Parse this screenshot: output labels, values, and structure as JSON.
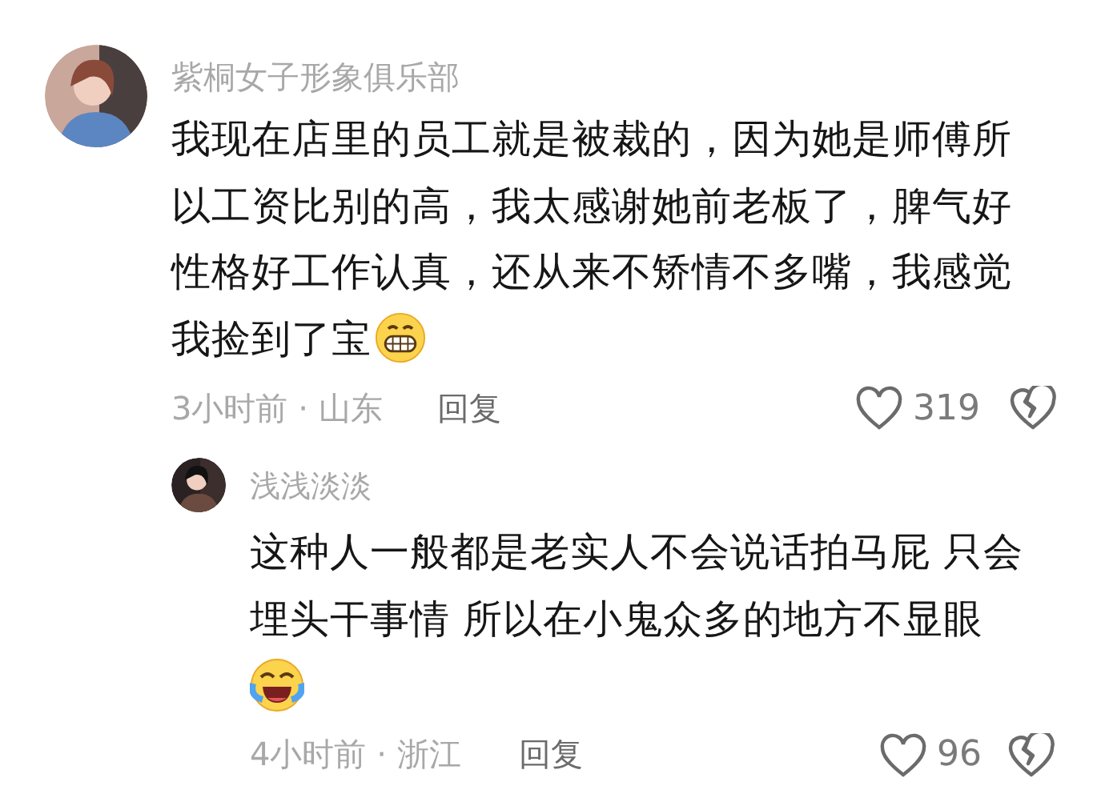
{
  "comments": [
    {
      "author": "紫桐女子形象俱乐部",
      "lines": [
        "我现在店里的员工就是被裁的，因为她是师傅所",
        "以工资比别的高，我太感谢她前老板了，脾气好",
        "性格好工作认真，还从来不矫情不多嘴，我感觉",
        "我捡到了宝"
      ],
      "emoji": {
        "kind": "grin"
      },
      "meta": "3小时前 · 山东",
      "reply_label": "回复",
      "likes": "319",
      "replies": [
        {
          "author": "浅浅淡淡",
          "lines": [
            "这种人一般都是老实人不会说话拍马屁 只会",
            "埋头干事情 所以在小鬼众多的地方不显眼"
          ],
          "emoji": {
            "kind": "laugh-cry"
          },
          "meta": "4小时前 · 浙江",
          "reply_label": "回复",
          "likes": "96"
        }
      ]
    }
  ]
}
